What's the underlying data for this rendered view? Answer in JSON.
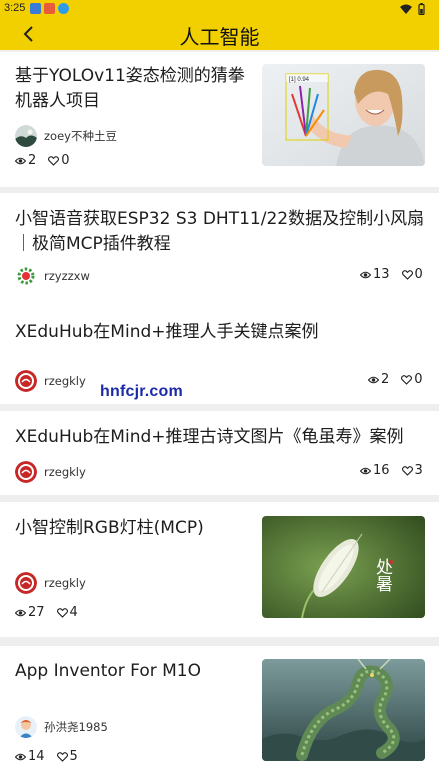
{
  "status_bar": {
    "time": "3:25"
  },
  "header": {
    "title": "人工智能"
  },
  "articles": [
    {
      "title": "基于YOLOv11姿态检测的猜拳机器人项目",
      "author": "zoey不种土豆",
      "views": "2",
      "likes": "0",
      "thumb_text": "[1] 0.94"
    },
    {
      "title": "小智语音获取ESP32 S3 DHT11/22数据及控制小风扇｜极简MCP插件教程",
      "author": "rzyzzxw",
      "views": "13",
      "likes": "0"
    },
    {
      "title": "XEduHub在Mind+推理人手关键点案例",
      "author": "rzegkly",
      "views": "2",
      "likes": "0"
    },
    {
      "title": "XEduHub在Mind+推理古诗文图片《龟虽寿》案例",
      "author": "rzegkly",
      "views": "16",
      "likes": "3"
    },
    {
      "title": "小智控制RGB灯柱(MCP)",
      "author": "rzegkly",
      "views": "27",
      "likes": "4",
      "thumb_text": "处暑"
    },
    {
      "title": "App Inventor For M1O",
      "author": "孙洪尧1985",
      "views": "14",
      "likes": "5"
    }
  ],
  "watermark": "hnfcjr.com",
  "icons": {
    "view": "eye-icon",
    "like": "heart-icon",
    "back": "back-arrow-icon"
  },
  "colors": {
    "header": "#f2d000",
    "card": "#ffffff",
    "divider": "#eeeeee"
  }
}
